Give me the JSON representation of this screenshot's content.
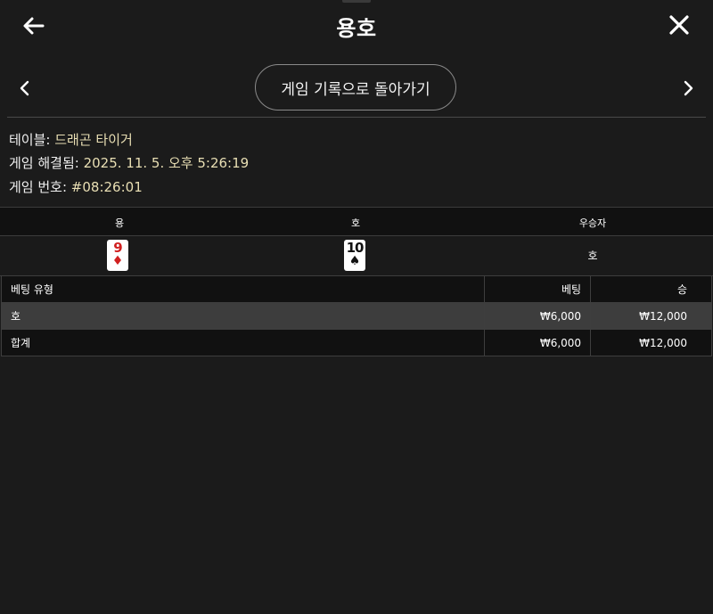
{
  "header": {
    "title": "용호"
  },
  "nav": {
    "history_label": "게임 기록으로 돌아가기"
  },
  "info": {
    "table_label": "테이블: ",
    "table_value": "드래곤 타이거",
    "resolved_label": "게임 해결됨: ",
    "resolved_value": "2025. 11. 5. 오후 5:26:19",
    "game_no_label": "게임 번호: ",
    "game_no_value": "#08:26:01"
  },
  "result": {
    "dragon_label": "용",
    "tiger_label": "호",
    "winner_label": "우승자",
    "dragon_card": {
      "rank": "9",
      "suit": "♦"
    },
    "tiger_card": {
      "rank": "10",
      "suit": "♠"
    },
    "winner_value": "호"
  },
  "bets": {
    "headers": {
      "type": "베팅 유형",
      "bet": "베팅",
      "win": "승"
    },
    "rows": [
      {
        "type": "호",
        "bet": "₩6,000",
        "win": "₩12,000"
      }
    ],
    "total": {
      "type": "합계",
      "bet": "₩6,000",
      "win": "₩12,000"
    }
  },
  "icons": {
    "back": "arrow-left-icon",
    "close": "close-icon",
    "prev": "chevron-left-icon",
    "next": "chevron-right-icon"
  },
  "colors": {
    "background": "#1b1b1b",
    "info_value": "#e9dfb4",
    "highlight_row": "#3d3d3d",
    "red_suit": "#d12020"
  }
}
